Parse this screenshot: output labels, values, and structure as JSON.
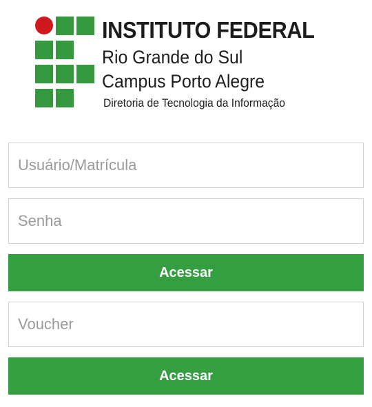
{
  "logo": {
    "title": "INSTITUTO FEDERAL",
    "line2": "Rio Grande do Sul",
    "line3": "Campus Porto Alegre",
    "line4": "Diretoria de Tecnologia da Informação",
    "colors": {
      "green": "#35993f",
      "red": "#d0191e"
    }
  },
  "login_form": {
    "username_placeholder": "Usuário/Matrícula",
    "username_value": "",
    "password_placeholder": "Senha",
    "password_value": "",
    "submit_label": "Acessar"
  },
  "voucher_form": {
    "voucher_placeholder": "Voucher",
    "voucher_value": "",
    "submit_label": "Acessar"
  },
  "colors": {
    "button_green": "#349e41",
    "border_gray": "#cfcfcf",
    "placeholder_gray": "#9a9a9a"
  }
}
